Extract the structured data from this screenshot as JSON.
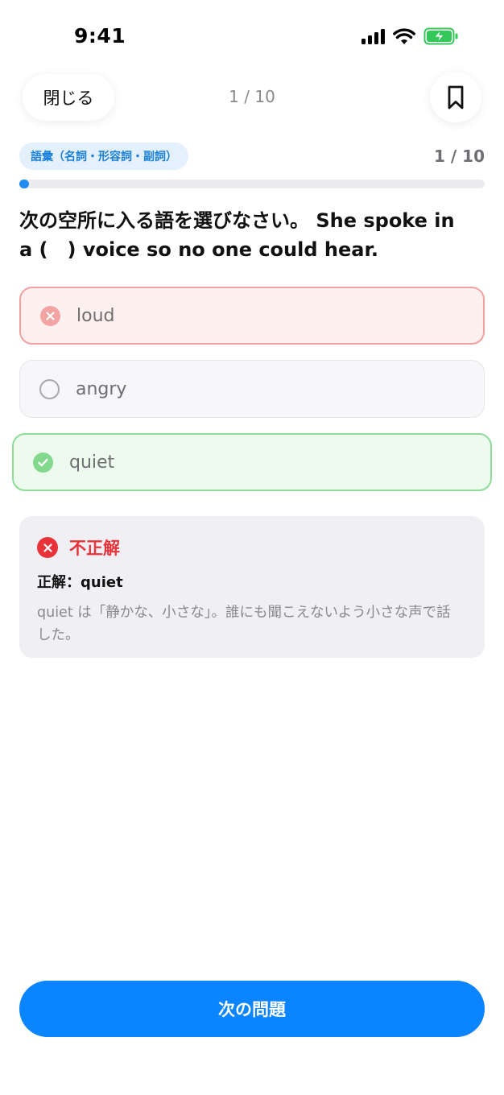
{
  "status_bar": {
    "time": "9:41",
    "signal_icon": "cellular-signal-icon",
    "wifi_icon": "wifi-icon",
    "battery_icon": "battery-charging-icon",
    "battery_color": "#34c759"
  },
  "header": {
    "close_label": "閉じる",
    "counter": "1 / 10",
    "bookmark_icon": "bookmark-icon"
  },
  "quiz": {
    "category": "語彙（名詞・形容詞・副詞）",
    "progress_label": "1 / 10",
    "progress_fraction": 0.02,
    "question": "次の空所に入る語を選びなさい。 She spoke in a (　) voice so no one could hear.",
    "options": [
      {
        "label": "loud",
        "state": "wrong-selected",
        "icon": "x-circle-icon"
      },
      {
        "label": "angry",
        "state": "unselected",
        "icon": "empty-circle-icon"
      },
      {
        "label": "quiet",
        "state": "correct",
        "icon": "check-circle-icon"
      }
    ]
  },
  "feedback": {
    "icon": "x-circle-icon",
    "status": "不正解",
    "answer": "正解：quiet",
    "explanation": "quiet は「静かな、小さな」。誰にも聞こえないよう小さな声で話した。"
  },
  "footer": {
    "next_label": "次の問題"
  },
  "colors": {
    "accent": "#0a84ff",
    "wrong": "#e8333a",
    "correct": "#82d88d",
    "badge_text": "#1a7fd9"
  }
}
